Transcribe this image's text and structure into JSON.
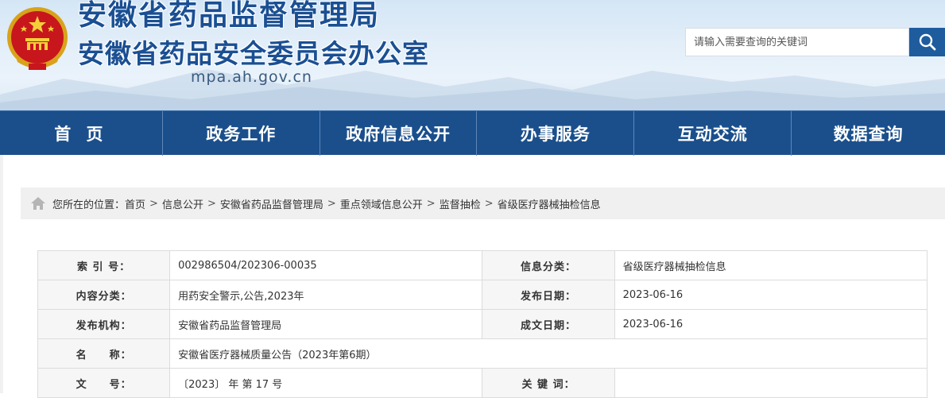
{
  "header": {
    "title_line1": "安徽省药品监督管理局",
    "title_line2": "安徽省药品安全委员会办公室",
    "domain": "mpa.ah.gov.cn",
    "emblem_icon": "national-emblem-icon"
  },
  "search": {
    "placeholder": "请输入需要查询的关键词",
    "button_icon": "search-icon"
  },
  "nav": {
    "items": [
      {
        "label": "首 页"
      },
      {
        "label": "政务工作"
      },
      {
        "label": "政府信息公开"
      },
      {
        "label": "办事服务"
      },
      {
        "label": "互动交流"
      },
      {
        "label": "数据查询"
      }
    ]
  },
  "breadcrumb": {
    "prefix": "您所在的位置：",
    "separator": ">",
    "items": [
      "首页",
      "信息公开",
      "安徽省药品监督管理局",
      "重点领域信息公开",
      "监督抽检",
      "省级医疗器械抽检信息"
    ]
  },
  "meta_table": {
    "rows": [
      {
        "label1": "索 引 号：",
        "value1": "002986504/202306-00035",
        "label2": "信息分类：",
        "value2": "省级医疗器械抽检信息"
      },
      {
        "label1": "内容分类：",
        "value1": "用药安全警示,公告,2023年",
        "label2": "发布日期：",
        "value2": "2023-06-16"
      },
      {
        "label1": "发布机构：",
        "value1": "安徽省药品监督管理局",
        "label2": "成文日期：",
        "value2": "2023-06-16"
      },
      {
        "label1": "名　　称：",
        "value1": "安徽省医疗器械质量公告（2023年第6期）"
      },
      {
        "label1": "文　　号：",
        "value1": "〔2023〕 年 第 17 号",
        "label2": "关 键 词：",
        "value2": ""
      }
    ]
  },
  "colors": {
    "brand_blue": "#1a4f8c",
    "title_blue": "#1a4f93",
    "search_button": "#1f5c9e"
  }
}
